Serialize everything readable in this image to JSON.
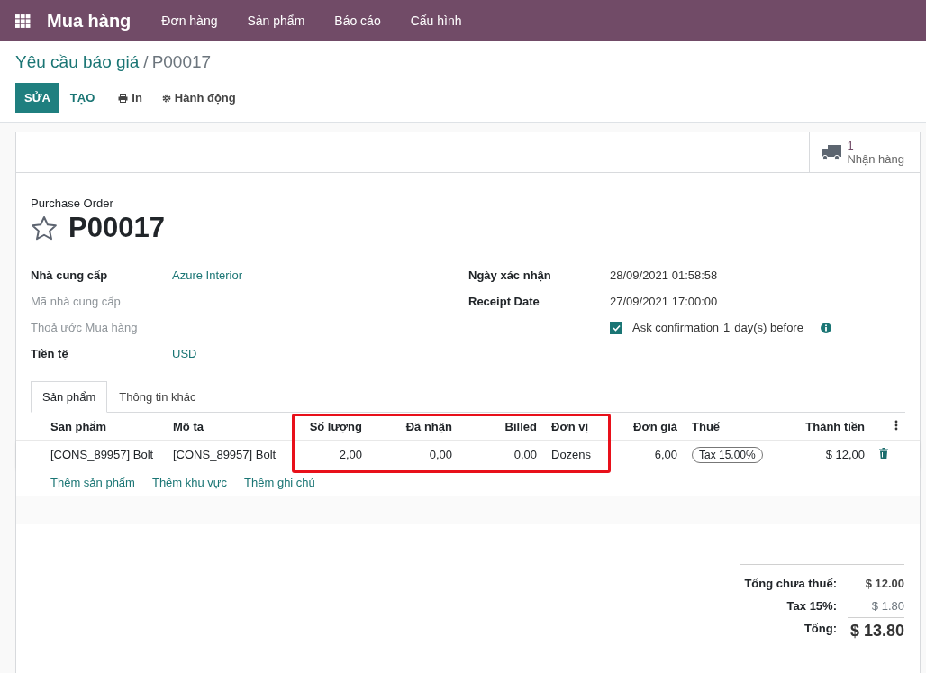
{
  "navbar": {
    "app_title": "Mua hàng",
    "menu": [
      "Đơn hàng",
      "Sản phẩm",
      "Báo cáo",
      "Cấu hình"
    ]
  },
  "breadcrumb": {
    "parent": "Yêu cầu báo giá",
    "separator": "/",
    "current": "P00017"
  },
  "actions": {
    "primary": "SỬA",
    "secondary": "TẠO",
    "print": "In",
    "action": "Hành động"
  },
  "smart_button": {
    "count": "1",
    "label": "Nhận hàng"
  },
  "form": {
    "subtitle": "Purchase Order",
    "name": "P00017",
    "starred": false,
    "left_fields": [
      {
        "label": "Nhà cung cấp",
        "value": "Azure Interior",
        "filled": true,
        "link": true
      },
      {
        "label": "Mã nhà cung cấp",
        "filled": false
      },
      {
        "label": "Thoả ước Mua hàng",
        "filled": false
      },
      {
        "label": "Tiền tệ",
        "value": "USD",
        "filled": true,
        "link": true
      }
    ],
    "right_fields": [
      {
        "kind": "text",
        "label": "Ngày xác nhận",
        "value": "28/09/2021 01:58:58"
      },
      {
        "kind": "text",
        "label": "Receipt Date",
        "value": "27/09/2021 17:00:00"
      },
      {
        "kind": "checkbox",
        "checked": true,
        "label": "Ask confirmation",
        "value": "1",
        "suffix": "day(s) before"
      }
    ]
  },
  "tabs": [
    {
      "label": "Sản phẩm",
      "selected": true
    },
    {
      "label": "Thông tin khác",
      "selected": false
    }
  ],
  "table": {
    "columns": [
      "Sản phẩm",
      "Mô tả",
      "Số lượng",
      "Đã nhận",
      "Billed",
      "Đơn vị",
      "Đơn giá",
      "Thuế",
      "Thành tiền"
    ],
    "rows": [
      {
        "product": "[CONS_89957] Bolt",
        "description": "[CONS_89957] Bolt",
        "quantity": "2,00",
        "received": "0,00",
        "billed": "0,00",
        "unit": "Dozens",
        "price": "6,00",
        "tax": "Tax 15.00%",
        "subtotal": "$ 12,00"
      }
    ],
    "add_links": [
      "Thêm sản phẩm",
      "Thêm khu vực",
      "Thêm ghi chú"
    ],
    "highlight": true
  },
  "totals": [
    {
      "label": "Tổng chưa thuế:",
      "value": "$ 12.00",
      "kind": "untaxed"
    },
    {
      "label": "Tax 15%:",
      "value": "$ 1.80",
      "kind": "tax"
    },
    {
      "label": "Tổng:",
      "value": "$ 13.80",
      "kind": "total"
    }
  ]
}
